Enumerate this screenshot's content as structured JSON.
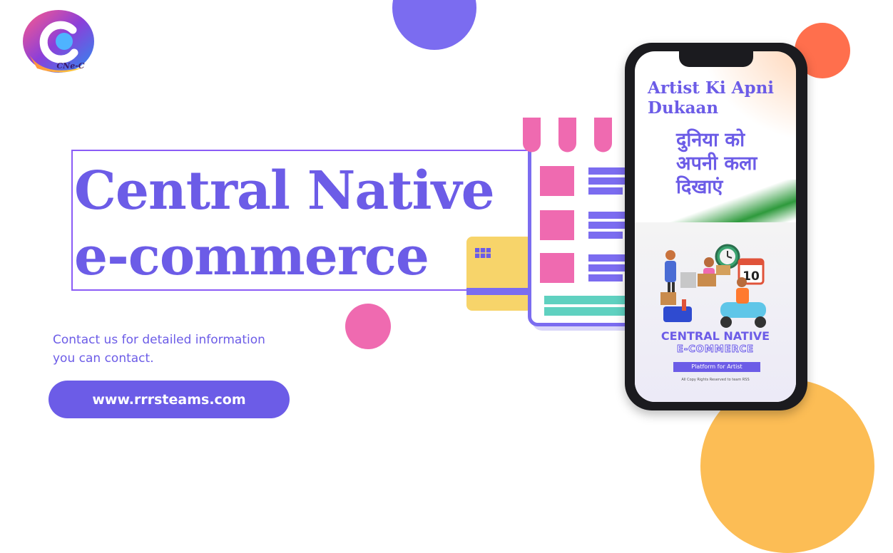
{
  "logo": {
    "text": "CNe-C",
    "icon": "cnec-logo"
  },
  "title": {
    "line1": "Central Native",
    "line2": "e-commerce"
  },
  "contact": {
    "line1": "Contact us for detailed information",
    "line2": "you can contact."
  },
  "url_button": {
    "label": "www.rrrsteams.com"
  },
  "phone": {
    "heading_line1": "Artist Ki Apni",
    "heading_line2": "Dukaan",
    "hindi_line1": "दुनिया को",
    "hindi_line2": "अपनी कला",
    "hindi_line3": "दिखाएं",
    "brand_line1": "CENTRAL NATIVE",
    "brand_line2": "E-COMMERCE",
    "badge": "Platform for Artist",
    "copyright": "All Copy Rights Reserved to team RSS",
    "calendar_number": "10"
  },
  "colors": {
    "primary": "#6c5ce7",
    "accent_pink": "#ef6ab0",
    "accent_orange": "#ff6f4d",
    "accent_yellow": "#fcbd55",
    "accent_teal": "#5fd1c0"
  }
}
